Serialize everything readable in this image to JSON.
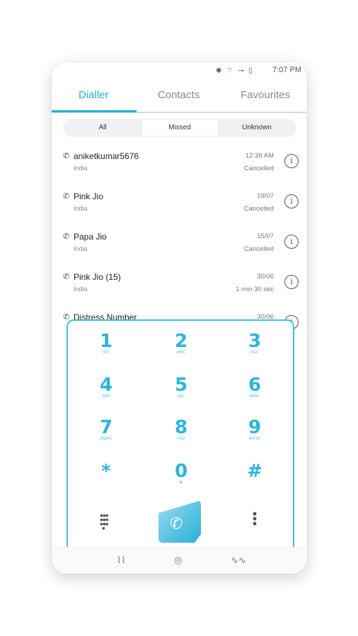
{
  "status_bar": {
    "icons": "✱ ⌔ ⊸ ▯",
    "time": "7:07 PM"
  },
  "tabs": [
    {
      "label": "Dialler"
    },
    {
      "label": "Contacts"
    },
    {
      "label": "Favourites"
    }
  ],
  "filters": [
    {
      "label": "All"
    },
    {
      "label": "Missed"
    },
    {
      "label": "Unknown"
    }
  ],
  "calls": [
    {
      "name": "aniketkumar5676",
      "location": "India",
      "time": "12:39 AM",
      "status": "Cancelled"
    },
    {
      "name": "Pink Jio",
      "location": "India",
      "time": "19/07",
      "status": "Cancelled"
    },
    {
      "name": "Papa Jio",
      "location": "India",
      "time": "15/07",
      "status": "Cancelled"
    },
    {
      "name": "Pink Jio (15)",
      "location": "India",
      "time": "30/06",
      "status": "1 min 30 sec"
    },
    {
      "name": "Distress Number",
      "location": "",
      "time": "30/06",
      "status": ""
    }
  ],
  "dialpad": {
    "keys": [
      {
        "num": "1",
        "sub": "OO"
      },
      {
        "num": "2",
        "sub": "ABC"
      },
      {
        "num": "3",
        "sub": "DEF"
      },
      {
        "num": "4",
        "sub": "GHI"
      },
      {
        "num": "5",
        "sub": "JKL"
      },
      {
        "num": "6",
        "sub": "MNO"
      },
      {
        "num": "7",
        "sub": "PQRS"
      },
      {
        "num": "8",
        "sub": "TUV"
      },
      {
        "num": "9",
        "sub": "WXYZ"
      },
      {
        "num": "*",
        "sub": ""
      },
      {
        "num": "0",
        "sub": "+"
      },
      {
        "num": "#",
        "sub": ""
      }
    ]
  },
  "colors": {
    "accent": "#1fb1d6"
  },
  "icons": {
    "call": "phone-icon",
    "info": "info-icon"
  }
}
